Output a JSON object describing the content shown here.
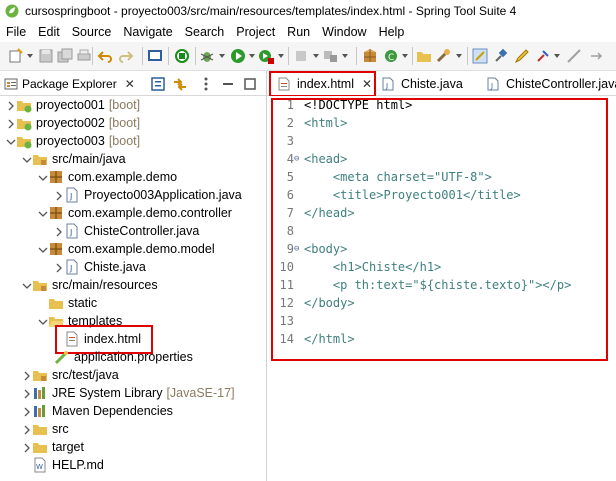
{
  "window": {
    "title": "cursospringboot - proyecto003/src/main/resources/templates/index.html - Spring Tool Suite 4"
  },
  "menu": [
    "File",
    "Edit",
    "Source",
    "Navigate",
    "Search",
    "Project",
    "Run",
    "Window",
    "Help"
  ],
  "package_explorer": {
    "tab_label": "Package Explorer",
    "tab_close": "✕",
    "items": [
      {
        "label": "proyecto001",
        "suffix": "[boot]"
      },
      {
        "label": "proyecto002",
        "suffix": "[boot]"
      },
      {
        "label": "proyecto003",
        "suffix": "[boot]"
      },
      {
        "label": "src/main/java"
      },
      {
        "label": "com.example.demo"
      },
      {
        "label": "Proyecto003Application.java"
      },
      {
        "label": "com.example.demo.controller"
      },
      {
        "label": "ChisteController.java"
      },
      {
        "label": "com.example.demo.model"
      },
      {
        "label": "Chiste.java"
      },
      {
        "label": "src/main/resources"
      },
      {
        "label": "static"
      },
      {
        "label": "templates"
      },
      {
        "label": "index.html"
      },
      {
        "label": "application.properties"
      },
      {
        "label": "src/test/java"
      },
      {
        "label": "JRE System Library",
        "suffix": "[JavaSE-17]"
      },
      {
        "label": "Maven Dependencies"
      },
      {
        "label": "src"
      },
      {
        "label": "target"
      },
      {
        "label": "HELP.md"
      }
    ]
  },
  "editor": {
    "tabs": [
      {
        "label": "index.html",
        "close": "✕"
      },
      {
        "label": "Chiste.java"
      },
      {
        "label": "ChisteController.java"
      }
    ],
    "lines": [
      {
        "n": "1",
        "t": "<!DOCTYPE html>"
      },
      {
        "n": "2",
        "t": "<html>"
      },
      {
        "n": "3",
        "t": ""
      },
      {
        "n": "4",
        "t": "<head>"
      },
      {
        "n": "5",
        "t": "    <meta charset=\"UTF-8\">"
      },
      {
        "n": "6",
        "t": "    <title>Proyecto001</title>"
      },
      {
        "n": "7",
        "t": "</head>"
      },
      {
        "n": "8",
        "t": ""
      },
      {
        "n": "9",
        "t": "<body>"
      },
      {
        "n": "10",
        "t": "    <h1>Chiste</h1>"
      },
      {
        "n": "11",
        "t": "    <p th:text=\"${chiste.texto}\"></p>"
      },
      {
        "n": "12",
        "t": "</body>"
      },
      {
        "n": "13",
        "t": ""
      },
      {
        "n": "14",
        "t": "</html>"
      }
    ]
  },
  "colors": {
    "highlight": "#e00000",
    "tag": "#3f7f7f",
    "string": "#2a00ff",
    "attr": "#7f8f9f"
  }
}
